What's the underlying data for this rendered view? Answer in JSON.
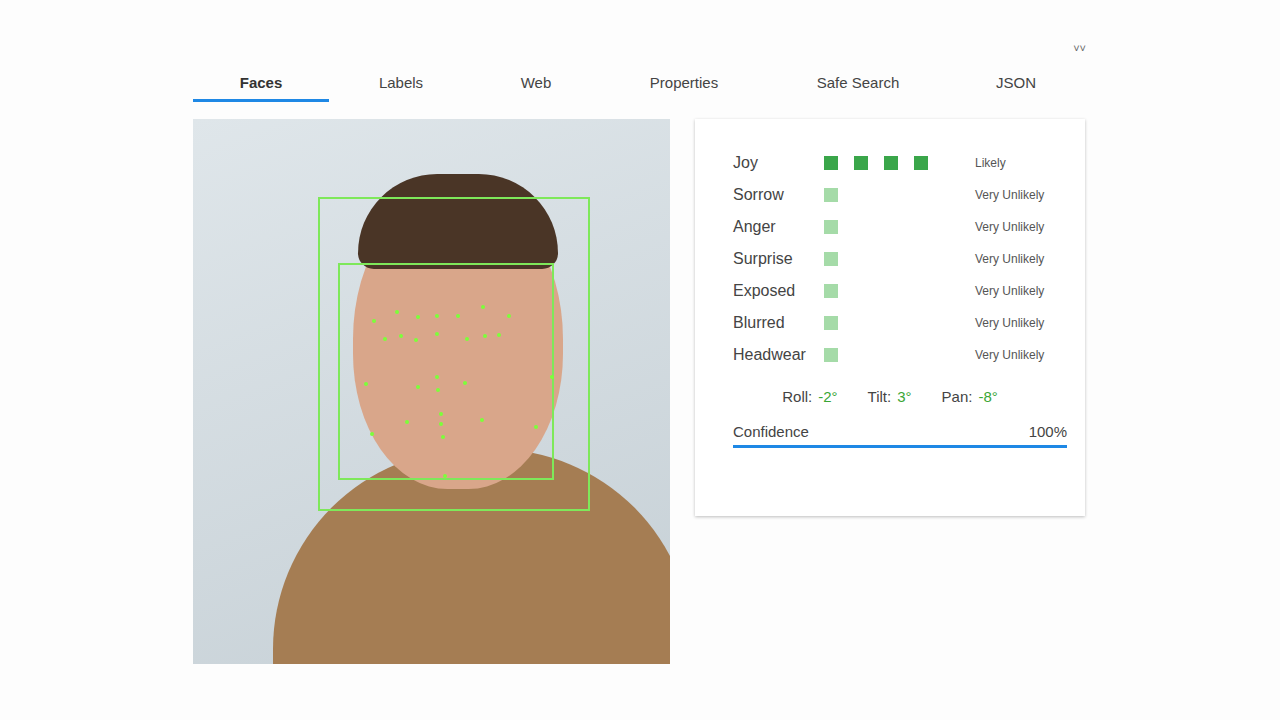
{
  "menu": "˅˅",
  "tabs": [
    {
      "label": "Faces",
      "selected": true
    },
    {
      "label": "Labels",
      "selected": false
    },
    {
      "label": "Web",
      "selected": false
    },
    {
      "label": "Properties",
      "selected": false
    },
    {
      "label": "Safe Search",
      "selected": false
    },
    {
      "label": "JSON",
      "selected": false
    }
  ],
  "likelihoods": [
    {
      "name": "Joy",
      "level": 0.8,
      "status": "Likely"
    },
    {
      "name": "Sorrow",
      "level": 0.2,
      "status": "Very Unlikely"
    },
    {
      "name": "Anger",
      "level": 0.2,
      "status": "Very Unlikely"
    },
    {
      "name": "Surprise",
      "level": 0.2,
      "status": "Very Unlikely"
    },
    {
      "name": "Exposed",
      "level": 0.2,
      "status": "Very Unlikely"
    },
    {
      "name": "Blurred",
      "level": 0.2,
      "status": "Very Unlikely"
    },
    {
      "name": "Headwear",
      "level": 0.2,
      "status": "Very Unlikely"
    }
  ],
  "pose": [
    {
      "label": "Roll:",
      "value": "-2°"
    },
    {
      "label": "Tilt:",
      "value": "3°"
    },
    {
      "label": "Pan:",
      "value": "-8°"
    }
  ],
  "confidence": {
    "label": "Confidence",
    "value": "100%",
    "level": 1.0
  }
}
